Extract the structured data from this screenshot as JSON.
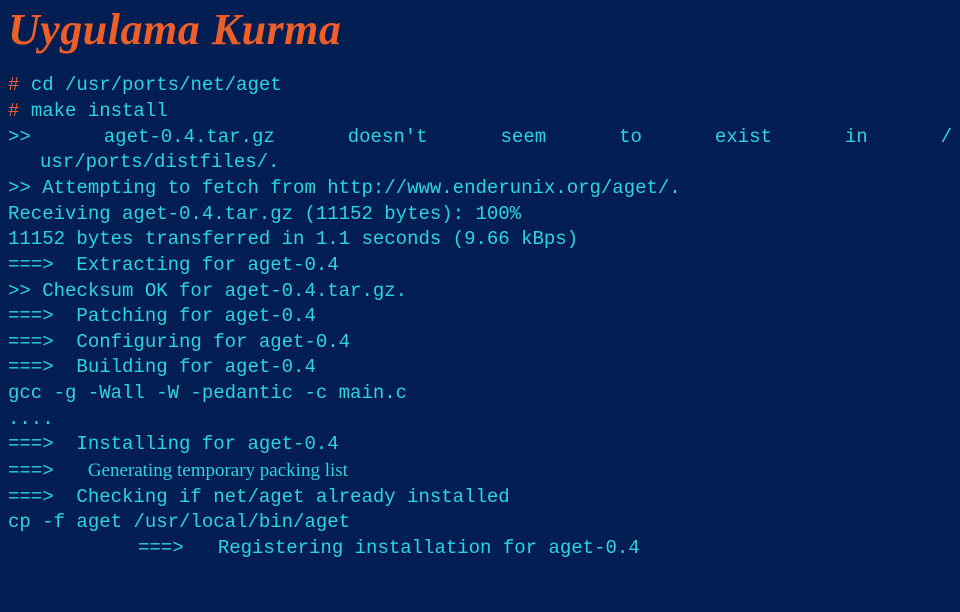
{
  "title": "Uygulama Kurma",
  "shell": {
    "prompt": "# ",
    "cmd1": "cd /usr/ports/net/aget",
    "cmd2": "make install"
  },
  "lines": {
    "l3_parts": [
      ">>",
      "aget-0.4.tar.gz",
      "doesn't",
      "seem",
      "to",
      "exist",
      "in",
      "/"
    ],
    "l3b": "usr/ports/distfiles/.",
    "l4": ">> Attempting to fetch from http://www.enderunix.org/aget/.",
    "l5": "Receiving aget-0.4.tar.gz (11152 bytes): 100%",
    "l6": "11152 bytes transferred in 1.1 seconds (9.66 kBps)",
    "l7": "===>  Extracting for aget-0.4",
    "l8": ">> Checksum OK for aget-0.4.tar.gz.",
    "l9": "===>  Patching for aget-0.4",
    "l10": "===>  Configuring for aget-0.4",
    "l11": "===>  Building for aget-0.4",
    "l12": "gcc -g -Wall -W -pedantic -c main.c",
    "l13": "....",
    "l14": "===>  Installing for aget-0.4",
    "l15a": "===>   ",
    "l15b": "Generating temporary packing list",
    "l16": "===>  Checking if net/aget already installed",
    "l17": "cp -f aget /usr/local/bin/aget",
    "l18": "===>   Registering installation for aget-0.4"
  }
}
